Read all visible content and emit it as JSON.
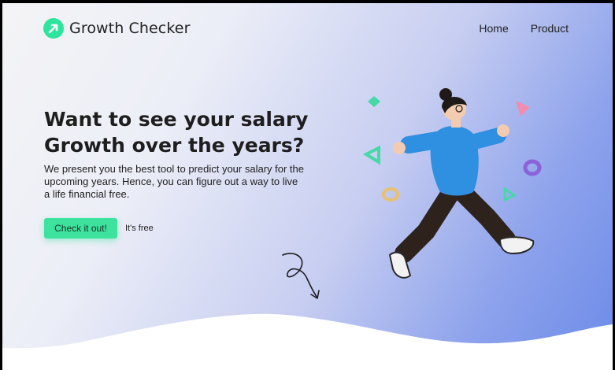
{
  "brand": {
    "name": "Growth Checker"
  },
  "nav": {
    "items": [
      "Home",
      "Product"
    ]
  },
  "hero": {
    "title_line1": "Want to see your salary",
    "title_line2": "Growth over the years?",
    "description": "We present you the best tool to predict your salary for the upcoming years. Hence, you can figure out a way to live a life financial free.",
    "cta_label": "Check it out!",
    "cta_note": "It's free"
  },
  "colors": {
    "accent": "#3de29e",
    "gradient_start": "#f4f4f6",
    "gradient_end": "#6b8ae8",
    "shirt": "#2f8fe0"
  },
  "icons": [
    "arrow-up-right-icon",
    "curly-arrow-icon"
  ]
}
